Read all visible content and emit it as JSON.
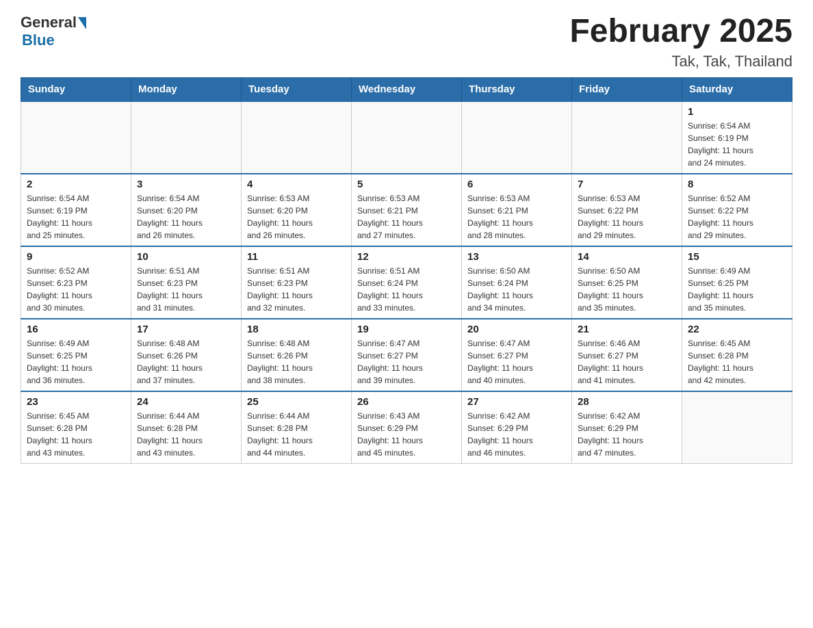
{
  "header": {
    "logo_general": "General",
    "logo_blue": "Blue",
    "month_title": "February 2025",
    "location": "Tak, Tak, Thailand"
  },
  "days_of_week": [
    "Sunday",
    "Monday",
    "Tuesday",
    "Wednesday",
    "Thursday",
    "Friday",
    "Saturday"
  ],
  "weeks": [
    [
      {
        "day": "",
        "info": ""
      },
      {
        "day": "",
        "info": ""
      },
      {
        "day": "",
        "info": ""
      },
      {
        "day": "",
        "info": ""
      },
      {
        "day": "",
        "info": ""
      },
      {
        "day": "",
        "info": ""
      },
      {
        "day": "1",
        "info": "Sunrise: 6:54 AM\nSunset: 6:19 PM\nDaylight: 11 hours\nand 24 minutes."
      }
    ],
    [
      {
        "day": "2",
        "info": "Sunrise: 6:54 AM\nSunset: 6:19 PM\nDaylight: 11 hours\nand 25 minutes."
      },
      {
        "day": "3",
        "info": "Sunrise: 6:54 AM\nSunset: 6:20 PM\nDaylight: 11 hours\nand 26 minutes."
      },
      {
        "day": "4",
        "info": "Sunrise: 6:53 AM\nSunset: 6:20 PM\nDaylight: 11 hours\nand 26 minutes."
      },
      {
        "day": "5",
        "info": "Sunrise: 6:53 AM\nSunset: 6:21 PM\nDaylight: 11 hours\nand 27 minutes."
      },
      {
        "day": "6",
        "info": "Sunrise: 6:53 AM\nSunset: 6:21 PM\nDaylight: 11 hours\nand 28 minutes."
      },
      {
        "day": "7",
        "info": "Sunrise: 6:53 AM\nSunset: 6:22 PM\nDaylight: 11 hours\nand 29 minutes."
      },
      {
        "day": "8",
        "info": "Sunrise: 6:52 AM\nSunset: 6:22 PM\nDaylight: 11 hours\nand 29 minutes."
      }
    ],
    [
      {
        "day": "9",
        "info": "Sunrise: 6:52 AM\nSunset: 6:23 PM\nDaylight: 11 hours\nand 30 minutes."
      },
      {
        "day": "10",
        "info": "Sunrise: 6:51 AM\nSunset: 6:23 PM\nDaylight: 11 hours\nand 31 minutes."
      },
      {
        "day": "11",
        "info": "Sunrise: 6:51 AM\nSunset: 6:23 PM\nDaylight: 11 hours\nand 32 minutes."
      },
      {
        "day": "12",
        "info": "Sunrise: 6:51 AM\nSunset: 6:24 PM\nDaylight: 11 hours\nand 33 minutes."
      },
      {
        "day": "13",
        "info": "Sunrise: 6:50 AM\nSunset: 6:24 PM\nDaylight: 11 hours\nand 34 minutes."
      },
      {
        "day": "14",
        "info": "Sunrise: 6:50 AM\nSunset: 6:25 PM\nDaylight: 11 hours\nand 35 minutes."
      },
      {
        "day": "15",
        "info": "Sunrise: 6:49 AM\nSunset: 6:25 PM\nDaylight: 11 hours\nand 35 minutes."
      }
    ],
    [
      {
        "day": "16",
        "info": "Sunrise: 6:49 AM\nSunset: 6:25 PM\nDaylight: 11 hours\nand 36 minutes."
      },
      {
        "day": "17",
        "info": "Sunrise: 6:48 AM\nSunset: 6:26 PM\nDaylight: 11 hours\nand 37 minutes."
      },
      {
        "day": "18",
        "info": "Sunrise: 6:48 AM\nSunset: 6:26 PM\nDaylight: 11 hours\nand 38 minutes."
      },
      {
        "day": "19",
        "info": "Sunrise: 6:47 AM\nSunset: 6:27 PM\nDaylight: 11 hours\nand 39 minutes."
      },
      {
        "day": "20",
        "info": "Sunrise: 6:47 AM\nSunset: 6:27 PM\nDaylight: 11 hours\nand 40 minutes."
      },
      {
        "day": "21",
        "info": "Sunrise: 6:46 AM\nSunset: 6:27 PM\nDaylight: 11 hours\nand 41 minutes."
      },
      {
        "day": "22",
        "info": "Sunrise: 6:45 AM\nSunset: 6:28 PM\nDaylight: 11 hours\nand 42 minutes."
      }
    ],
    [
      {
        "day": "23",
        "info": "Sunrise: 6:45 AM\nSunset: 6:28 PM\nDaylight: 11 hours\nand 43 minutes."
      },
      {
        "day": "24",
        "info": "Sunrise: 6:44 AM\nSunset: 6:28 PM\nDaylight: 11 hours\nand 43 minutes."
      },
      {
        "day": "25",
        "info": "Sunrise: 6:44 AM\nSunset: 6:28 PM\nDaylight: 11 hours\nand 44 minutes."
      },
      {
        "day": "26",
        "info": "Sunrise: 6:43 AM\nSunset: 6:29 PM\nDaylight: 11 hours\nand 45 minutes."
      },
      {
        "day": "27",
        "info": "Sunrise: 6:42 AM\nSunset: 6:29 PM\nDaylight: 11 hours\nand 46 minutes."
      },
      {
        "day": "28",
        "info": "Sunrise: 6:42 AM\nSunset: 6:29 PM\nDaylight: 11 hours\nand 47 minutes."
      },
      {
        "day": "",
        "info": ""
      }
    ]
  ],
  "colors": {
    "header_bg": "#2a6da8",
    "header_text": "#ffffff",
    "accent": "#1a6fa8"
  }
}
